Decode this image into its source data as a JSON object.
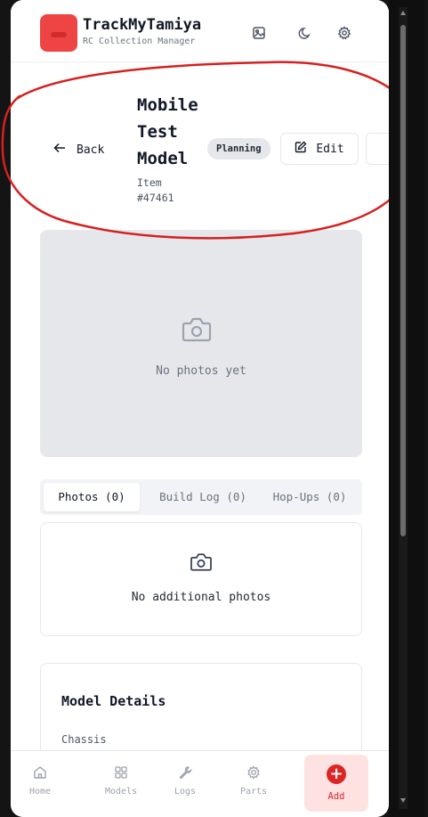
{
  "header": {
    "title": "TrackMyTamiya",
    "subtitle": "RC Collection Manager",
    "icons": [
      "gallery-icon",
      "moon-icon",
      "settings-icon"
    ]
  },
  "model": {
    "back_label": "Back",
    "title": "Mobile Test Model",
    "item_label": "Item #47461",
    "status": "Planning",
    "edit_label": "Edit"
  },
  "photos": {
    "empty_text": "No photos yet"
  },
  "tabs": [
    {
      "label": "Photos (0)",
      "active": true
    },
    {
      "label": "Build Log (0)",
      "active": false
    },
    {
      "label": "Hop-Ups (0)",
      "active": false
    }
  ],
  "additional": {
    "empty_text": "No additional photos"
  },
  "details": {
    "title": "Model Details",
    "chassis_label": "Chassis"
  },
  "nav": {
    "items": [
      {
        "label": "Home",
        "icon": "home-icon"
      },
      {
        "label": "Models",
        "icon": "grid-icon"
      },
      {
        "label": "Logs",
        "icon": "wrench-icon"
      },
      {
        "label": "Parts",
        "icon": "gear-icon"
      },
      {
        "label": "Add",
        "icon": "plus-icon"
      }
    ]
  },
  "colors": {
    "brand": "#ef4444",
    "annotation": "#d62020"
  }
}
